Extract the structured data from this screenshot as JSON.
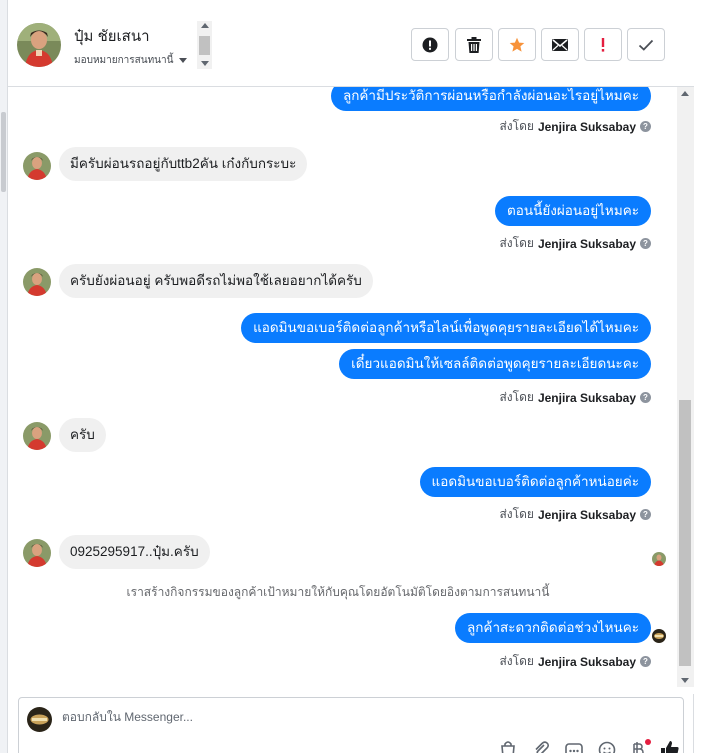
{
  "header": {
    "contact_name": "ปุ๋ม ชัยเสนา",
    "assign_label": "มอบหมายการสนทนานี้",
    "actions": [
      {
        "name": "report-spam",
        "icon": "alert-circle-icon"
      },
      {
        "name": "delete",
        "icon": "trash-icon"
      },
      {
        "name": "star",
        "icon": "star-icon",
        "color": "#f7923a"
      },
      {
        "name": "mark-unread",
        "icon": "envelope-icon"
      },
      {
        "name": "mark-important",
        "icon": "exclamation-icon",
        "color": "#e41e3f"
      },
      {
        "name": "mark-done",
        "icon": "check-icon"
      }
    ]
  },
  "colors": {
    "outgoing_bubble": "#0a7cff",
    "incoming_bubble": "#f0f0f0",
    "star": "#f7923a",
    "important": "#e41e3f"
  },
  "messages": [
    {
      "direction": "out",
      "text": "ลูกค้ามีประวัติการผ่อนหรือกำลังผ่อนอะไรอยู่ไหมคะ"
    },
    {
      "direction": "sent_by",
      "prefix": "ส่งโดย",
      "name": "Jenjira Suksabay"
    },
    {
      "direction": "in",
      "text": "มีครับผ่อนรถอยู่กับttb2คัน เก๋งกับกระบะ"
    },
    {
      "direction": "out",
      "text": "ตอนนี้ยังผ่อนอยู่ไหมคะ"
    },
    {
      "direction": "sent_by",
      "prefix": "ส่งโดย",
      "name": "Jenjira Suksabay"
    },
    {
      "direction": "in",
      "text": "ครับยังผ่อนอยู่ ครับพอดีรถไม่พอใช้เลยอยากได้ครับ"
    },
    {
      "direction": "out",
      "text": "แอดมินขอเบอร์ติดต่อลูกค้าหรือไลน์เพื่อพูดคุยรายละเอียดได้ไหมคะ"
    },
    {
      "direction": "out",
      "text": "เดี๋ยวแอดมินให้เซลล์ติดต่อพูดคุยรายละเอียดนะคะ"
    },
    {
      "direction": "sent_by",
      "prefix": "ส่งโดย",
      "name": "Jenjira Suksabay"
    },
    {
      "direction": "in",
      "text": "ครับ"
    },
    {
      "direction": "out",
      "text": "แอดมินขอเบอร์ติดต่อลูกค้าหน่อยค่ะ"
    },
    {
      "direction": "sent_by",
      "prefix": "ส่งโดย",
      "name": "Jenjira Suksabay"
    },
    {
      "direction": "in",
      "text": "0925295917..ปุ๋ม.ครับ"
    },
    {
      "direction": "system",
      "text": "เราสร้างกิจกรรมของลูกค้าเป้าหมายให้กับคุณโดยอัตโนมัติโดยอิงตามการสนทนานี้"
    },
    {
      "direction": "out",
      "text": "ลูกค้าสะดวกติดต่อช่วงไหนคะ"
    },
    {
      "direction": "sent_by",
      "prefix": "ส่งโดย",
      "name": "Jenjira Suksabay"
    }
  ],
  "composer": {
    "placeholder": "ตอบกลับใน Messenger...",
    "tools": [
      "shopping-bag-icon",
      "paperclip-icon",
      "saved-reply-icon",
      "emoji-icon",
      "baht-payment-icon",
      "thumbs-up-icon"
    ]
  }
}
